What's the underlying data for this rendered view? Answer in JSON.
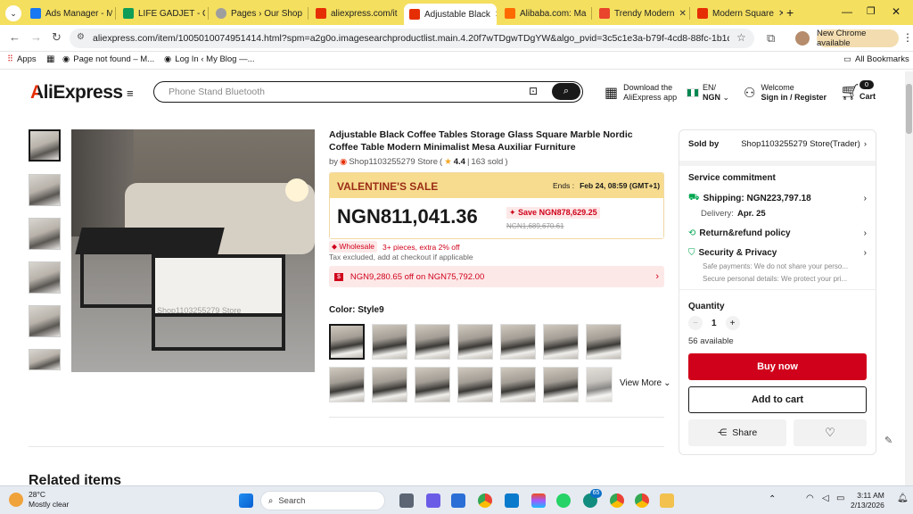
{
  "browser": {
    "tabs": [
      {
        "label": "Ads Manager - M",
        "color": "#1877f2"
      },
      {
        "label": "LIFE GADJET - G",
        "color": "#0f9d58"
      },
      {
        "label": "Pages › Our Shop",
        "color": "#9e9e9e"
      },
      {
        "label": "aliexpress.com/it",
        "color": "#e62e04"
      },
      {
        "label": "Adjustable Black",
        "color": "#e62e04"
      },
      {
        "label": "Alibaba.com: Ma",
        "color": "#ff6a00"
      },
      {
        "label": "Trendy Modern",
        "color": "#e8452c"
      },
      {
        "label": "Modern Square",
        "color": "#e62e04"
      }
    ],
    "url": "aliexpress.com/item/1005010074951414.html?spm=a2g0o.imagesearchproductlist.main.4.20f7wTDgwTDgYW&algo_pvid=3c5c1e3a-b79f-4cd8-88fc-1b1d3853d493&algo_...",
    "new_chrome": "New Chrome available",
    "bookmarks": [
      "Apps",
      "Page not found – M...",
      "Log In ‹ My Blog —..."
    ],
    "all_bookmarks": "All Bookmarks"
  },
  "header": {
    "logo": "AliExpress",
    "search_placeholder": "Phone Stand Bluetooth",
    "download_line1": "Download the",
    "download_line2": "AliExpress app",
    "lang": "EN/",
    "currency": "NGN",
    "welcome": "Welcome",
    "signin": "Sign in / Register",
    "cart_count": "0",
    "cart_label": "Cart"
  },
  "product": {
    "title": "Adjustable Black Coffee Tables Storage Glass Square Marble Nordic Coffee Table Modern Minimalist Mesa Auxiliar Furniture",
    "by": "by",
    "store": "Shop1103255279 Store",
    "rating": "4.4",
    "sold": "163 sold",
    "watermark": "Shop1103255279 Store",
    "sale_banner": "VALENTINE'S SALE",
    "ends": "Ends :",
    "ends_date": "Feb 24, 08:59 (GMT+1)",
    "price": "NGN811,041.36",
    "save": "Save NGN878,629.25",
    "old_price": "NGN1,689,670.61",
    "wholesale": "Wholesale",
    "wholesale_text": "3+ pieces, extra 2% off",
    "tax": "Tax excluded, add at checkout if applicable",
    "coupon": "NGN9,280.65 off on NGN75,792.00",
    "color_label": "Color: Style9",
    "view_more": "View More",
    "related": "Related items"
  },
  "sidebar": {
    "sold_by_label": "Sold by",
    "sold_by_value": "Shop1103255279 Store(Trader)",
    "service": "Service commitment",
    "shipping": "Shipping: NGN223,797.18",
    "delivery_label": "Delivery:",
    "delivery_date": "Apr. 25",
    "return": "Return&refund policy",
    "security": "Security & Privacy",
    "safe_pay": "Safe payments: We do not share your perso...",
    "secure_details": "Secure personal details: We protect your pri...",
    "quantity_label": "Quantity",
    "quantity": "1",
    "available": "56 available",
    "buy_now": "Buy now",
    "add_to_cart": "Add to cart",
    "share": "Share"
  },
  "taskbar": {
    "temp": "28°C",
    "weather": "Mostly clear",
    "search": "Search",
    "time": "3:11 AM",
    "date": "2/13/2026",
    "badge": "65"
  }
}
